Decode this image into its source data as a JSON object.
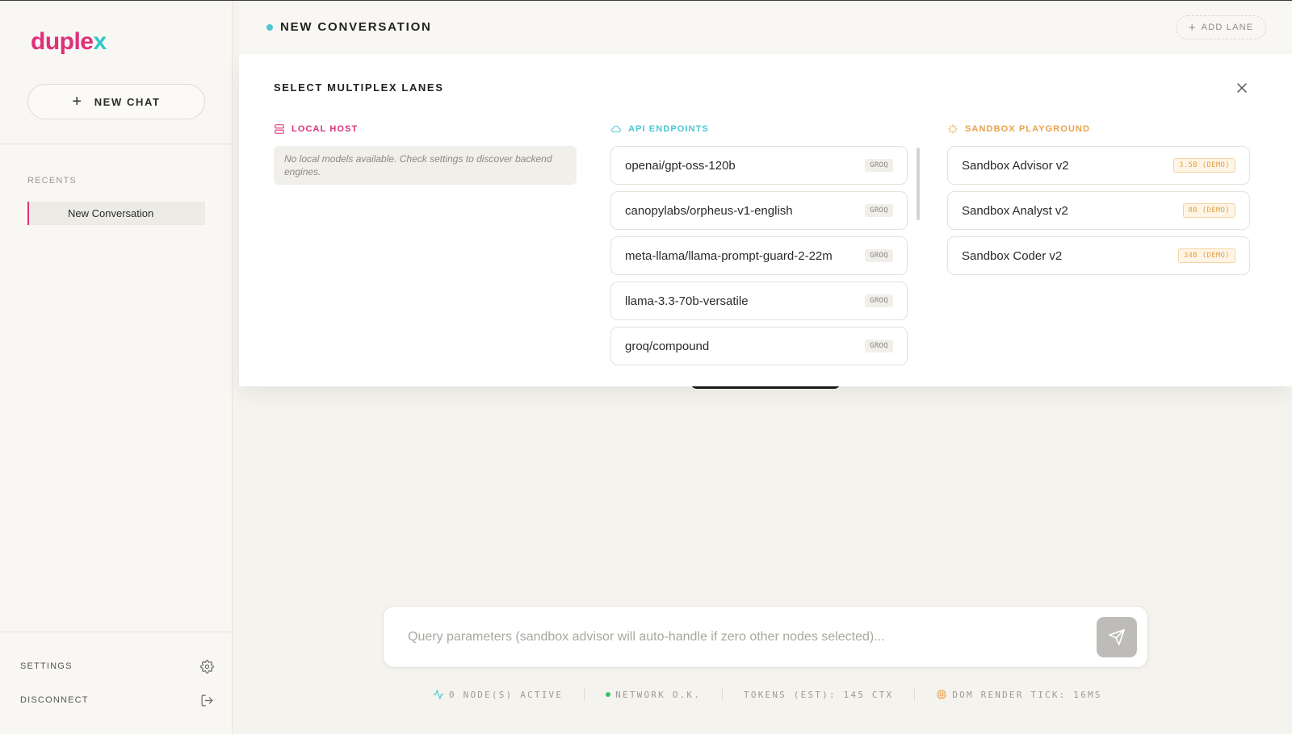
{
  "app": {
    "logo_part1": "duple",
    "logo_part2": "x"
  },
  "sidebar": {
    "new_chat_label": "NEW CHAT",
    "recents_label": "RECENTS",
    "recent_items": [
      {
        "label": "New Conversation",
        "active": true
      }
    ],
    "settings_label": "SETTINGS",
    "disconnect_label": "DISCONNECT"
  },
  "header": {
    "conversation_title": "NEW CONVERSATION",
    "add_lane_label": "ADD LANE"
  },
  "lane_selector": {
    "title": "SELECT MULTIPLEX LANES",
    "local": {
      "heading": "LOCAL HOST",
      "color": "#e0307a",
      "empty_message": "No local models available. Check settings to discover backend engines."
    },
    "api": {
      "heading": "API ENDPOINTS",
      "color": "#4bc7d2",
      "models": [
        {
          "name": "openai/gpt-oss-120b",
          "tag": "GROQ"
        },
        {
          "name": "canopylabs/orpheus-v1-english",
          "tag": "GROQ"
        },
        {
          "name": "meta-llama/llama-prompt-guard-2-22m",
          "tag": "GROQ"
        },
        {
          "name": "llama-3.3-70b-versatile",
          "tag": "GROQ"
        },
        {
          "name": "groq/compound",
          "tag": "GROQ"
        }
      ]
    },
    "sandbox": {
      "heading": "SANDBOX PLAYGROUND",
      "color": "#e8a24c",
      "models": [
        {
          "name": "Sandbox Advisor v2",
          "tag": "3.5B (DEMO)"
        },
        {
          "name": "Sandbox Analyst v2",
          "tag": "8B (DEMO)"
        },
        {
          "name": "Sandbox Coder v2",
          "tag": "34B (DEMO)"
        }
      ]
    }
  },
  "query": {
    "placeholder": "Query parameters (sandbox advisor will auto-handle if zero other nodes selected)...",
    "value": ""
  },
  "status_bar": {
    "nodes": "0 NODE(S) ACTIVE",
    "network": "NETWORK O.K.",
    "tokens": "TOKENS (EST): 145 CTX",
    "render": "DOM RENDER TICK: 16MS"
  },
  "icons": {
    "close": "close-icon",
    "settings": "gear-icon",
    "disconnect": "logout-icon",
    "send": "send-icon",
    "local": "server-icon",
    "api": "cloud-icon",
    "sandbox": "sparkle-icon",
    "activity": "activity-icon",
    "chip": "chip-icon"
  }
}
